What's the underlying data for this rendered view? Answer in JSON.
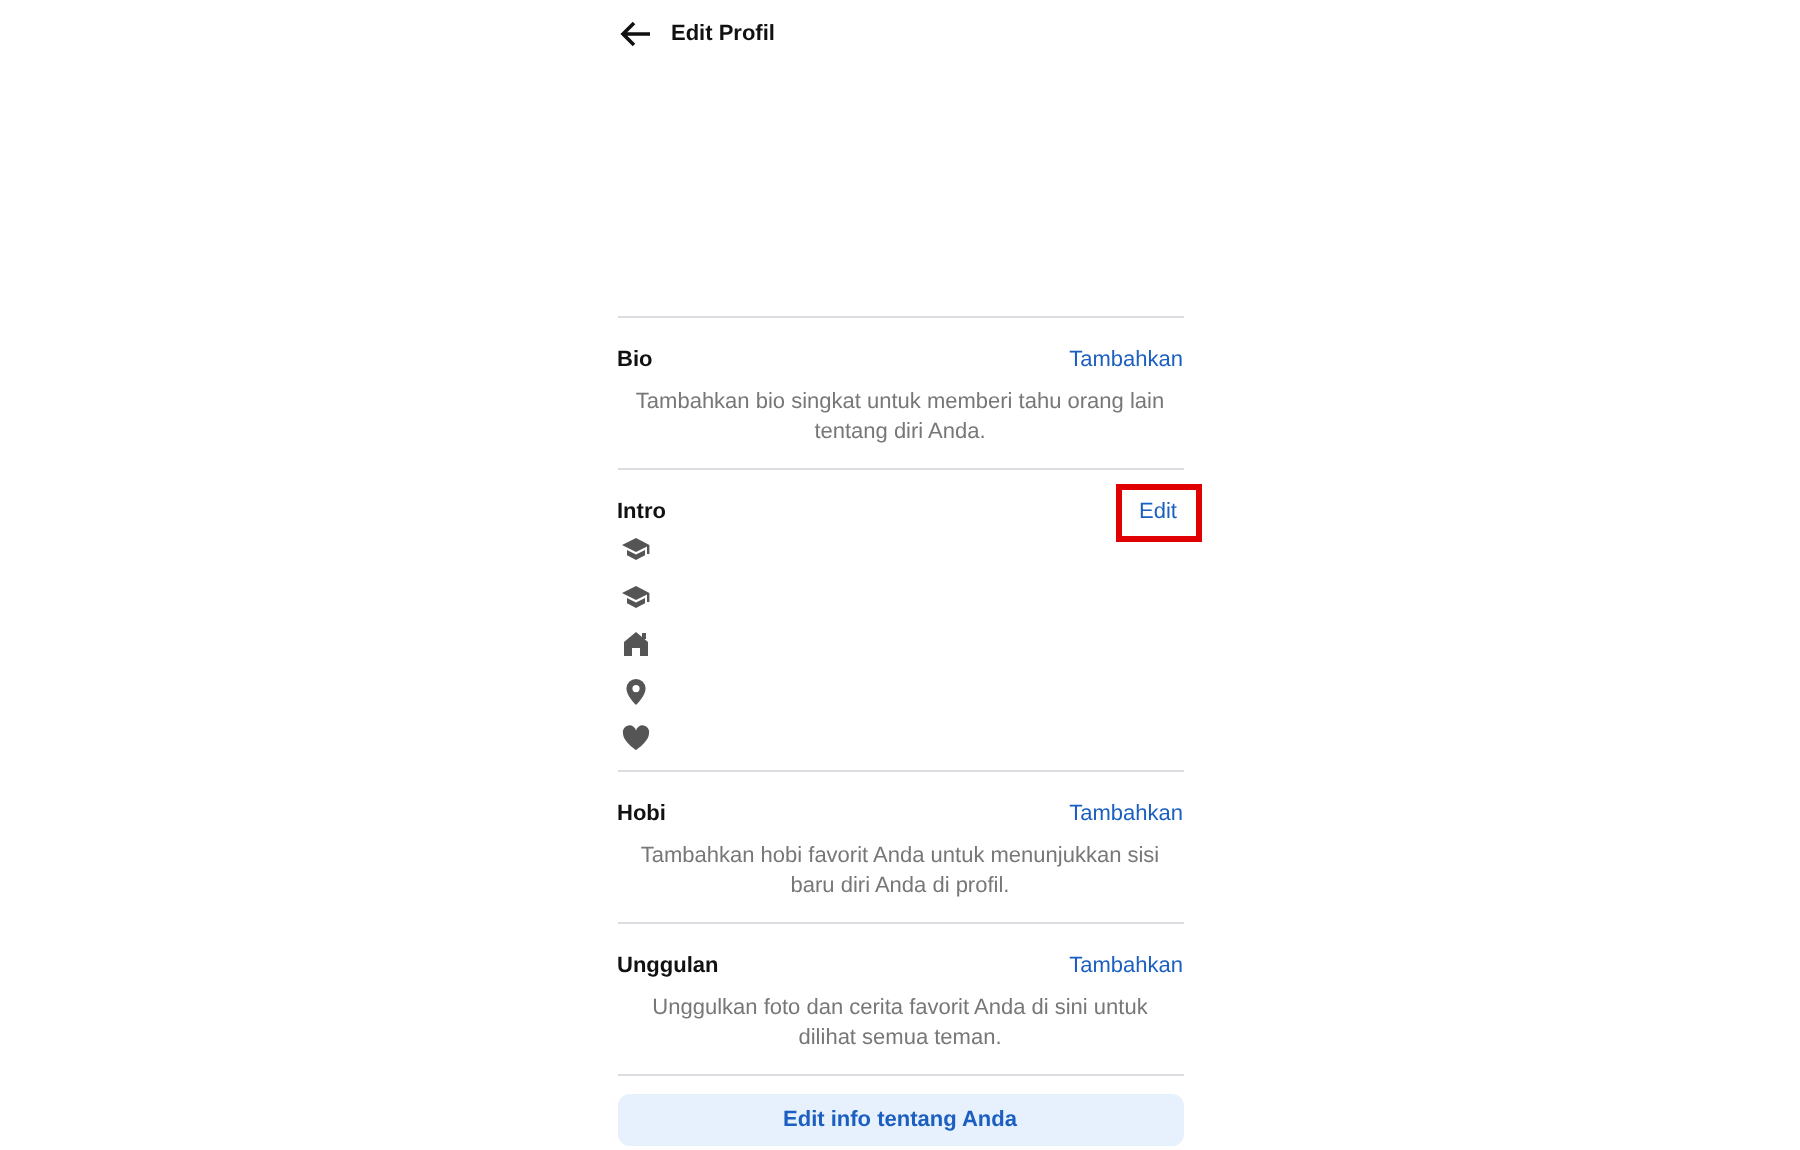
{
  "header": {
    "title": "Edit Profil"
  },
  "sections": [
    {
      "kind": "text",
      "title": "Bio",
      "action": {
        "label": "Tambahkan",
        "highlighted": false
      },
      "description": "Tambahkan bio singkat untuk memberi tahu orang lain tentang diri Anda."
    },
    {
      "kind": "icons",
      "title": "Intro",
      "action": {
        "label": "Edit",
        "highlighted": true
      },
      "icons": [
        {
          "kind": "school"
        },
        {
          "kind": "school"
        },
        {
          "kind": "home"
        },
        {
          "kind": "pin"
        },
        {
          "kind": "heart"
        }
      ]
    },
    {
      "kind": "text",
      "title": "Hobi",
      "action": {
        "label": "Tambahkan",
        "highlighted": false
      },
      "description": "Tambahkan hobi favorit Anda untuk menunjukkan sisi baru diri Anda di profil."
    },
    {
      "kind": "text",
      "title": "Unggulan",
      "action": {
        "label": "Tambahkan",
        "highlighted": false
      },
      "description": "Unggulkan foto dan cerita favorit Anda di sini untuk dilihat semua teman."
    }
  ],
  "footer_button": {
    "label": "Edit info tentang Anda"
  }
}
